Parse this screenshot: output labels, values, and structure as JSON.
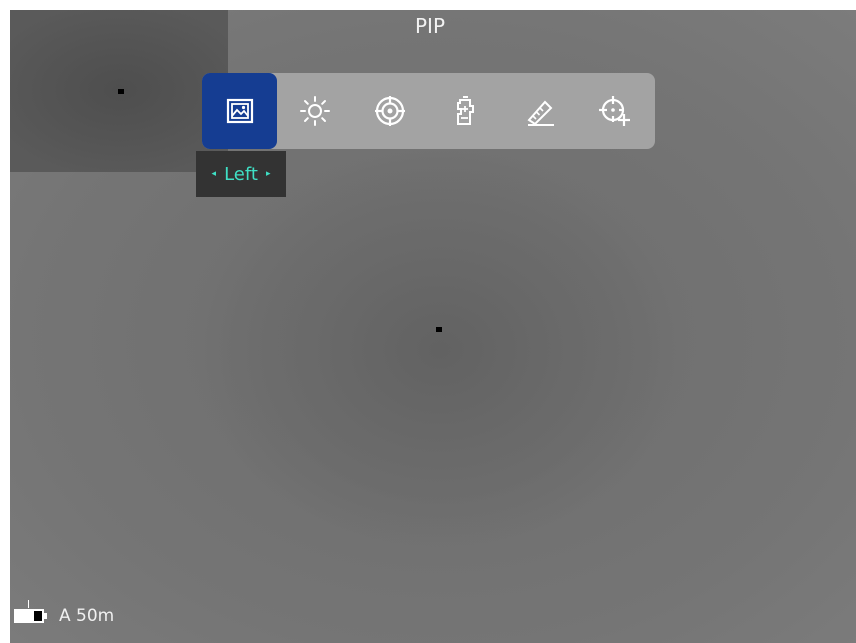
{
  "mode_title": "PIP",
  "toolbar": {
    "items": [
      {
        "name": "image-mode",
        "icon": "picture-icon",
        "active": true
      },
      {
        "name": "brightness",
        "icon": "sun-icon",
        "active": false
      },
      {
        "name": "reticle",
        "icon": "crosshair-target-icon",
        "active": false
      },
      {
        "name": "zeroing",
        "icon": "rifle-zero-icon",
        "active": false
      },
      {
        "name": "ranging",
        "icon": "ruler-pencil-icon",
        "active": false
      },
      {
        "name": "add-reticle",
        "icon": "crosshair-plus-icon",
        "active": false
      }
    ],
    "active_color": "#153d92"
  },
  "tooltip": {
    "label": "Left",
    "left_arrow": "◂",
    "right_arrow": "▸",
    "color": "#3fe0c5"
  },
  "status": {
    "battery_level": 0.7,
    "range_text": "A 50m"
  }
}
